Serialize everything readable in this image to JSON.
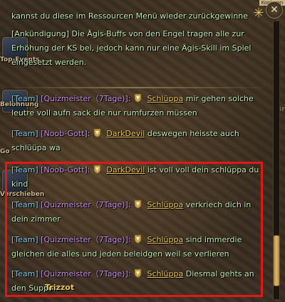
{
  "hud": {
    "top_events_label": "Top-Events",
    "belohnung_label": "Belohnung",
    "gold_label": "Go",
    "verschieben_label": "Verschieben",
    "side_tag": "Br",
    "corner_tag": "Kopieren"
  },
  "chat": {
    "messages": [
      {
        "channel": "",
        "sender": "",
        "user": "",
        "text": "kannst du diese im Ressourcen Menü wieder zurückgewinne"
      },
      {
        "channel": "",
        "sender": "",
        "user": "",
        "text": "[Ankündigung] Die Ägis-Buffs von den Engel tragen alle zur Erhöhung der KS bei, jedoch kann nur eine Ägis-Skill im Spiel eingesetzt werden."
      },
      {
        "channel": "[Team]",
        "sender": "[Quizmeister（7Tage)]:",
        "user": "Schlüppa",
        "text": "mir gehen solche leutre voll aufn sack die nur rumfurzen müssen"
      },
      {
        "channel": "[Team]",
        "sender": "[Noob-Gott]:",
        "user": "DarkDevil",
        "text": "deswegen heisste auch schlüüpa wa"
      },
      {
        "channel": "[Team]",
        "sender": "[Noob-Gott]:",
        "user": "DarkDevil",
        "text": "ist voll voll dein schlüppa du kind"
      },
      {
        "channel": "[Team]",
        "sender": "[Quizmeister（7Tage)]:",
        "user": "Schlüppa",
        "text": "verkriech dich in dein zimmer"
      },
      {
        "channel": "[Team]",
        "sender": "[Quizmeister（7Tage)]:",
        "user": "Schlüppa",
        "text": "sind immerdie gleichen die alles und jeden beleidgen weil se verlieren"
      },
      {
        "channel": "[Team]",
        "sender": "[Quizmeister（7Tage)]:",
        "user": "Schlüppa",
        "text": "Diesmal gehts an den Support"
      }
    ]
  },
  "overlay_name": "Trizzot",
  "scroll": {
    "position_fraction": 0.88
  },
  "colors": {
    "highlight": "#e01818",
    "team": "#7ec7e8",
    "sender": "#c58be8",
    "user": "#e8c45a",
    "text": "#bfe6b2"
  }
}
